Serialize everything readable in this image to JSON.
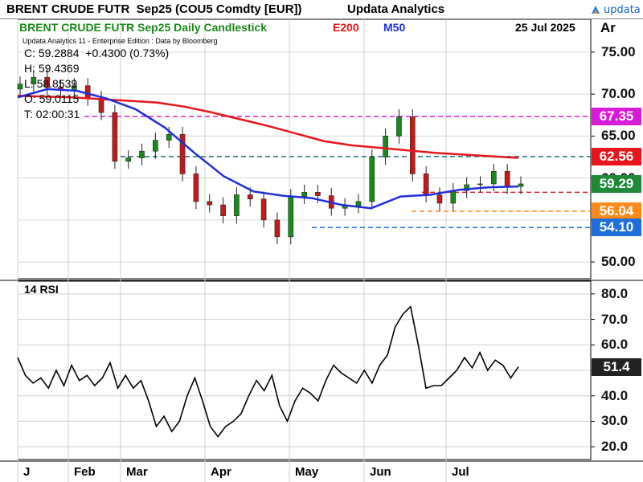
{
  "header": {
    "title": "BRENT CRUDE FUTR  Sep25 (COU5 Comdty [EUR])",
    "company": "Updata Analytics",
    "logo_text": "updata"
  },
  "subtitle": {
    "chart_name": "BRENT CRUDE FUTR  Sep25 Daily Candlestick",
    "ma200_label": "E200",
    "ma50_label": "M50",
    "date": "25 Jul 2025",
    "axis_currency": "Ar"
  },
  "source_note": "Updata Analytics 11 - Enterprise Edition : Data by Bloomberg",
  "ohlc": {
    "close": "C: 59.2884  +0.4300 (0.73%)",
    "high": "H: 59.4369",
    "low": "L: 58.8539",
    "open": "O: 59.0115",
    "time": "T: 02:00:31"
  },
  "rsi_label": "14 RSI",
  "colors": {
    "ma200": "#e8151b",
    "ma50": "#1f2fd8",
    "green_title": "#1a8a1a",
    "bull_candle": "#1a8a1a",
    "bear_candle": "#c41a1a",
    "level_magenta": "#d81bd8",
    "level_red": "#d9232a",
    "level_green": "#1e8a36",
    "level_orange": "#ff8a1a",
    "level_blue": "#1e6fd9",
    "level_teal": "#207070"
  },
  "chart_data": [
    {
      "type": "candlestick",
      "title": "BRENT CRUDE FUTR  Sep25 Daily Candlestick",
      "ylim": [
        48,
        77
      ],
      "y_ticks": [
        "50.00",
        "55.00",
        "60.00",
        "65.00",
        "70.00",
        "75.00"
      ],
      "x_months": [
        "J",
        "Feb",
        "Mar",
        "Apr",
        "May",
        "Jun",
        "Jul"
      ],
      "grid": true,
      "series": [
        {
          "name": "E200",
          "values": [
            69.8,
            69.7,
            69.6,
            69.4,
            69.2,
            69.0,
            68.5,
            67.8,
            67.0,
            66.2,
            65.3,
            64.4,
            63.9,
            63.6,
            63.3,
            63.0,
            62.8,
            62.6,
            62.4
          ]
        },
        {
          "name": "M50",
          "values": [
            69.6,
            70.6,
            70.4,
            69.5,
            68.2,
            66.0,
            63.0,
            60.2,
            58.4,
            57.9,
            57.6,
            56.8,
            56.4,
            57.8,
            58.0,
            58.6,
            58.9,
            59.0
          ]
        }
      ],
      "close_values": [
        71.2,
        72.0,
        70.8,
        70.5,
        71.0,
        69.5,
        67.8,
        62.0,
        62.4,
        63.2,
        64.5,
        65.2,
        60.5,
        57.2,
        56.8,
        55.5,
        58.0,
        57.5,
        55.0,
        53.0,
        57.8,
        58.3,
        57.9,
        56.4,
        56.7,
        57.2,
        62.5,
        65.0,
        67.3,
        60.5,
        58.0,
        57.0,
        58.5,
        59.2,
        59.3,
        60.8,
        59.0,
        59.3
      ],
      "levels": [
        {
          "value": 67.35,
          "label": "67.35",
          "style": "magenta"
        },
        {
          "value": 62.56,
          "label": "62.56",
          "style": "teal"
        },
        {
          "value": 58.3,
          "label": "",
          "style": "red"
        },
        {
          "value": 56.04,
          "label": "56.04",
          "style": "orange"
        },
        {
          "value": 54.1,
          "label": "54.10",
          "style": "blue"
        }
      ],
      "price_tags": [
        {
          "value": 67.35,
          "label": "67.35",
          "color": "#d81bd8"
        },
        {
          "value": 62.56,
          "label": "62.56",
          "color": "#e8151b"
        },
        {
          "value": 59.29,
          "label": "59.29",
          "color": "#1e8a36"
        },
        {
          "value": 56.04,
          "label": "56.04",
          "color": "#ff8a1a"
        },
        {
          "value": 54.1,
          "label": "54.10",
          "color": "#1e6fd9"
        }
      ]
    },
    {
      "type": "line",
      "title": "14 RSI",
      "ylim": [
        15,
        85
      ],
      "y_ticks": [
        "20.0",
        "30.0",
        "40.0",
        "50.0",
        "60.0",
        "70.0",
        "80.0"
      ],
      "series": [
        {
          "name": "14 RSI",
          "values": [
            55,
            48,
            45,
            47,
            43,
            50,
            44,
            52,
            46,
            48,
            44,
            47,
            53,
            43,
            48,
            43,
            46,
            38,
            28,
            32,
            26,
            30,
            40,
            47,
            38,
            28,
            24,
            28,
            30,
            33,
            40,
            46,
            42,
            48,
            36,
            30,
            38,
            43,
            41,
            38,
            46,
            52,
            49,
            47,
            45,
            50,
            45,
            52,
            56,
            67,
            72,
            75,
            60,
            43,
            44,
            44,
            47,
            50,
            55,
            51,
            57,
            50,
            54,
            52,
            47,
            51.4
          ]
        }
      ],
      "current_value": "51.4"
    }
  ]
}
